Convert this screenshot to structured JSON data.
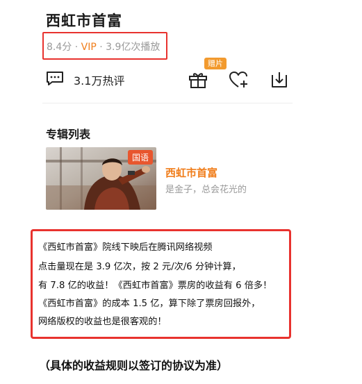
{
  "movie": {
    "title": "西虹市首富",
    "meta": {
      "rating": "8.4分",
      "sep1": " · ",
      "vip": "VIP",
      "sep2": " · ",
      "plays": "3.9亿次播放"
    }
  },
  "actions": {
    "comment_count": "3.1万热评",
    "gift_badge": "赠片",
    "icons": [
      "comment-icon",
      "gift-icon",
      "heart-plus-icon",
      "download-icon"
    ]
  },
  "album": {
    "section_title": "专辑列表",
    "item": {
      "lang_tag": "国语",
      "title": "西虹市首富",
      "subtitle": "是金子，总会花光的"
    }
  },
  "note": {
    "lines": [
      "《西虹市首富》院线下映后在腾讯网络视频",
      "点击量现在是 3.9 亿次，按 2 元/次/6 分钟计算，",
      "有 7.8 亿的收益！《西虹市首富》票房的收益有 6 倍多！",
      "《西虹市首富》的成本 1.5 亿，算下除了票房回报外，",
      "网络版权的收益也是很客观的！"
    ]
  },
  "footer": {
    "text": "（具体的收益规则以签订的协议为准）"
  },
  "colors": {
    "accent_orange": "#f07d1a",
    "highlight_red": "#e8322e",
    "meta_gray": "#999999"
  }
}
